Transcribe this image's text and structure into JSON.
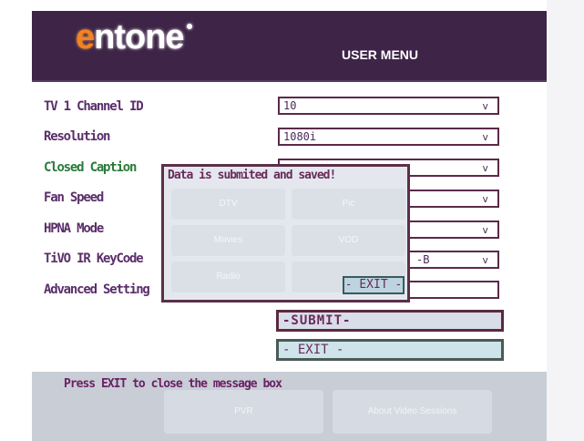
{
  "header": {
    "logo_first": "e",
    "logo_rest": "ntone",
    "title": "USER MENU"
  },
  "form": {
    "fields": [
      {
        "label": "TV 1 Channel ID",
        "value": "10",
        "arrow": "v"
      },
      {
        "label": "Resolution",
        "value": "1080i",
        "arrow": "v"
      },
      {
        "label": "Closed Caption",
        "value": "",
        "arrow": "v"
      },
      {
        "label": "Fan Speed",
        "value": "",
        "arrow": "v"
      },
      {
        "label": "HPNA Mode",
        "value": "",
        "arrow": "v"
      },
      {
        "label": "TiVO IR KeyCode",
        "value": "-B",
        "arrow": "v"
      },
      {
        "label": "Advanced Setting",
        "value": "",
        "arrow": ""
      }
    ],
    "submit_label": "-SUBMIT-",
    "exit_label": "- EXIT -"
  },
  "modal": {
    "message": "Data is submited and saved!",
    "exit_label": "- EXIT -",
    "bg_tiles": [
      "DTV",
      "Pic",
      "Movies",
      "VOD",
      "Radio",
      ""
    ]
  },
  "bottom": {
    "hint": "Press EXIT to close the message box",
    "tiles": [
      "PVR",
      "About Video Sessions"
    ]
  }
}
